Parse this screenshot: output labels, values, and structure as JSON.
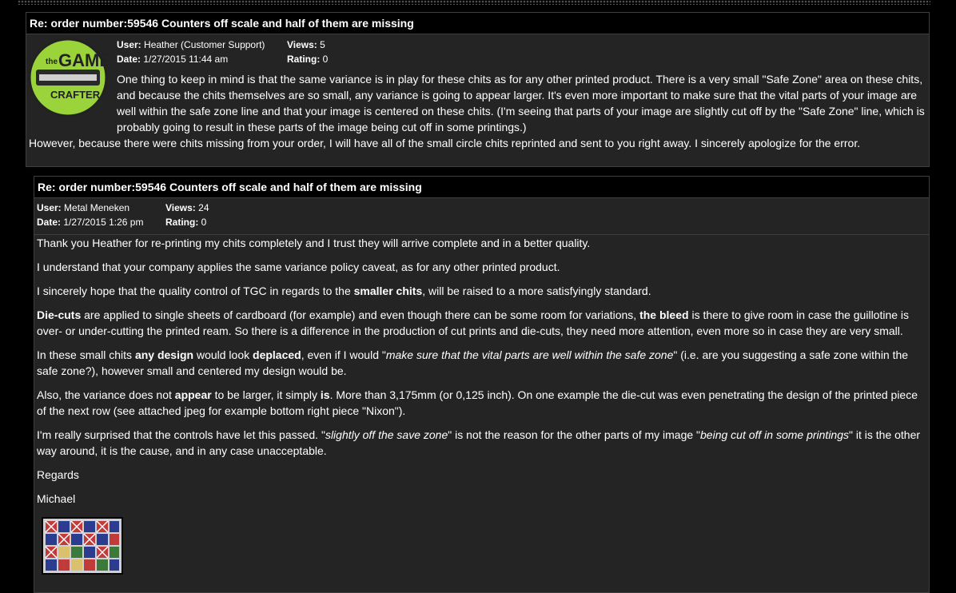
{
  "post1": {
    "title": "Re: order number:59546 Counters off scale and half of them are missing",
    "user_label": "User:",
    "user": "Heather (Customer Support)",
    "date_label": "Date:",
    "date": "1/27/2015 11:44 am",
    "views_label": "Views:",
    "views": "5",
    "rating_label": "Rating:",
    "rating": "0",
    "logo_text_top": "the",
    "logo_text_game": "GAME",
    "logo_text_crafter": "CRAFTER",
    "para1": "One thing to keep in mind is that the same variance is in play for these chits as for any other printed product.  There is a very small \"Safe Zone\" area on these chits, and because the chits themselves are so small, any variance is going to appear larger.  It's even more important to make sure that the vital parts of your image are well within the safe zone line and that your image is centered on these chits.  (I'm seeing that parts of your image are slightly cut off by the \"Safe Zone\" line, which is probably going to result in these parts of the image being cut off in some printings.)",
    "para2": "However, because there were chits missing from your order, I will have all of the small circle chits reprinted and sent to you right away.  I sincerely apologize for the error."
  },
  "post2": {
    "title": "Re: order number:59546 Counters off scale and half of them are missing",
    "user_label": "User:",
    "user": "Metal Meneken",
    "date_label": "Date:",
    "date": "1/27/2015 1:26 pm",
    "views_label": "Views:",
    "views": "24",
    "rating_label": "Rating:",
    "rating": "0",
    "p1": "Thank you Heather for re-printing my chits completely and I trust they will arrive complete and in a better quality.",
    "p2": "I understand that your company applies the same variance policy caveat, as for any other printed product.",
    "p3a": "I sincerely hope that the quality control of TGC in regards to the ",
    "p3b": "smaller chits",
    "p3c": ", will be raised to a more satisfyingly standard.",
    "p4a": "Die-cuts",
    "p4b": " are applied to single sheets of cardboard (for example) and even though there can be some room for variations, ",
    "p4c": "the bleed",
    "p4d": " is there to give room in case the guillotine is over- or under-cutting the printed ream. So there is a difference in the production of cut prints and die-cuts, they need more attention, even more so in case they are very small.",
    "p5a": "In these small chits ",
    "p5b": "any design",
    "p5c": " would look ",
    "p5d": "deplaced",
    "p5e": ", even if I would \"",
    "p5f": "make sure that the vital parts are well within the safe zone",
    "p5g": "\" (i.e. are you suggesting a safe zone within the safe zone?), however small and centered my design would be.",
    "p6a": "Also, the variance does not ",
    "p6b": "appear",
    "p6c": " to be larger, it simply ",
    "p6d": "is",
    "p6e": ". More than 3,175mm (or 0,125 inch). On one example the die-cut was even penetrating the design of the printed piece of the next row (see attached jpeg for example bottom right piece \"Nixon\").",
    "p7a": "I'm really surprised that the controls have let this passed. \"",
    "p7b": "slightly off the save zone",
    "p7c": "\" is not the reason for the other parts of my image \"",
    "p7d": "being cut off in some printings",
    "p7e": "\" it is the other way around, it is the cause, and in any case unacceptable.",
    "p8": "Regards",
    "p9": "Michael"
  },
  "colors": {
    "background": "#000000",
    "post_bg": "#242424",
    "border": "#3e3e3e",
    "logo_green": "#9bd33a"
  }
}
